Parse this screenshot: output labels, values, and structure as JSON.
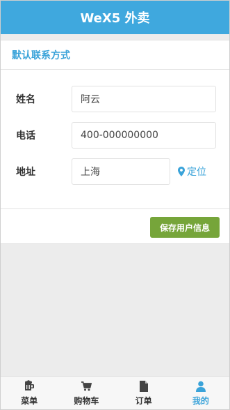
{
  "header": {
    "title": "WeX5 外卖"
  },
  "contact": {
    "section_title": "默认联系方式",
    "name": {
      "label": "姓名",
      "value": "阿云"
    },
    "phone": {
      "label": "电话",
      "value": "400-000000000"
    },
    "address": {
      "label": "地址",
      "value": "上海"
    },
    "locate_label": "定位",
    "save_label": "保存用户信息"
  },
  "tabs": [
    {
      "label": "菜单",
      "icon": "beer-mug-icon",
      "active": false
    },
    {
      "label": "购物车",
      "icon": "cart-icon",
      "active": false
    },
    {
      "label": "订单",
      "icon": "document-icon",
      "active": false
    },
    {
      "label": "我的",
      "icon": "user-icon",
      "active": true
    }
  ],
  "colors": {
    "accent": "#3fa8de",
    "save_button": "#76a53a"
  }
}
